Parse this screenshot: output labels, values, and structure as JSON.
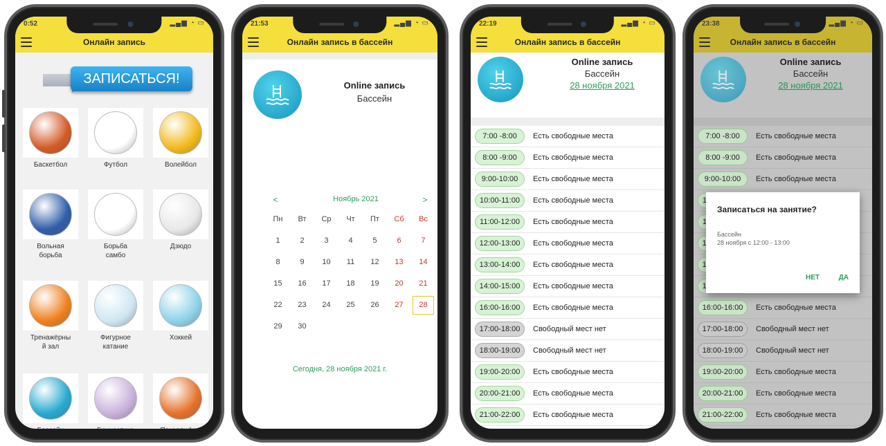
{
  "phone1": {
    "time": "0:52",
    "title": "Онлайн запись",
    "signup_label": "ЗАПИСАТЬСЯ!",
    "sports": [
      {
        "label": "Баскетбол",
        "icon": "basketball-icon",
        "color": "#d35a26"
      },
      {
        "label": "Футбол",
        "icon": "soccer-ball-icon",
        "color": "#ffffff"
      },
      {
        "label": "Волейбол",
        "icon": "volleyball-icon",
        "color": "#f2b91b"
      },
      {
        "label": "Вольная\nборьба",
        "icon": "wrestling-icon",
        "color": "#2f5da8"
      },
      {
        "label": "Борьба\nсамбо",
        "icon": "sambo-icon",
        "color": "#ffffff"
      },
      {
        "label": "Дзюдо",
        "icon": "judo-icon",
        "color": "#e8e8e8"
      },
      {
        "label": "Тренажёрны\nй зал",
        "icon": "dumbbell-icon",
        "color": "#f0801d"
      },
      {
        "label": "Фигурное\nкатание",
        "icon": "figure-skating-icon",
        "color": "#cfe7f2"
      },
      {
        "label": "Хоккей",
        "icon": "hockey-goal-icon",
        "color": "#8fd2ea"
      },
      {
        "label": "Бассейн",
        "icon": "pool-icon",
        "color": "#27a9d0"
      },
      {
        "label": "Гимнастика",
        "icon": "gymnastics-icon",
        "color": "#c9b1dc"
      },
      {
        "label": "Пауэрлифт...",
        "icon": "powerlifting-icon",
        "color": "#e6712a"
      }
    ]
  },
  "phone2": {
    "time": "21:53",
    "title": "Онлайн запись в бассейн",
    "header_line1": "Online запись",
    "header_line2": "Бассейн",
    "calendar": {
      "prev": "<",
      "next": ">",
      "month": "Ноябрь 2021",
      "weekdays": [
        "Пн",
        "Вт",
        "Ср",
        "Чт",
        "Пт",
        "Сб",
        "Вс"
      ],
      "weeks": [
        [
          "1",
          "2",
          "3",
          "4",
          "5",
          "6",
          "7"
        ],
        [
          "8",
          "9",
          "10",
          "11",
          "12",
          "13",
          "14"
        ],
        [
          "15",
          "16",
          "17",
          "18",
          "19",
          "20",
          "21"
        ],
        [
          "22",
          "23",
          "24",
          "25",
          "26",
          "27",
          "28"
        ],
        [
          "29",
          "30",
          "",
          "",
          "",
          "",
          ""
        ]
      ],
      "selected": "28"
    },
    "today": "Сегодня, 28 ноября 2021 г."
  },
  "phone3": {
    "time": "22:19",
    "title": "Онлайн запись в бассейн",
    "header_line1": "Online запись",
    "header_line2": "Бассейн",
    "date": "28 ноября 2021",
    "slots": [
      {
        "time": "7:00 -8:00",
        "status": "Есть свободные места",
        "free": true
      },
      {
        "time": "8:00 -9:00",
        "status": "Есть свободные места",
        "free": true
      },
      {
        "time": "9:00-10:00",
        "status": "Есть свободные места",
        "free": true
      },
      {
        "time": "10:00-11:00",
        "status": "Есть свободные места",
        "free": true
      },
      {
        "time": "11:00-12:00",
        "status": "Есть свободные места",
        "free": true
      },
      {
        "time": "12:00-13:00",
        "status": "Есть свободные места",
        "free": true
      },
      {
        "time": "13:00-14:00",
        "status": "Есть свободные места",
        "free": true
      },
      {
        "time": "14:00-15:00",
        "status": "Есть свободные места",
        "free": true
      },
      {
        "time": "16:00-16:00",
        "status": "Есть свободные места",
        "free": true
      },
      {
        "time": "17:00-18:00",
        "status": "Свободный мест нет",
        "free": false
      },
      {
        "time": "18:00-19:00",
        "status": "Свободный мест нет",
        "free": false
      },
      {
        "time": "19:00-20:00",
        "status": "Есть свободные места",
        "free": true
      },
      {
        "time": "20:00-21:00",
        "status": "Есть свободные места",
        "free": true
      },
      {
        "time": "21:00-22:00",
        "status": "Есть свободные места",
        "free": true
      }
    ]
  },
  "phone4": {
    "time": "23:38",
    "title": "Онлайн запись в бассейн",
    "header_line1": "Online запись",
    "header_line2": "Бассейн",
    "date": "28 ноября 2021",
    "dialog": {
      "title": "Записаться на занятие?",
      "line1": "Бассейн",
      "line2": "28 ноября с 12:00 - 13:00",
      "no": "НЕТ",
      "yes": "ДА"
    }
  },
  "colors": {
    "appbar": "#f4df3c",
    "accent_green": "#2e9c5b",
    "weekend_red": "#c0392b",
    "chip_free": "#d8f2d6",
    "chip_full": "#d5d5d5",
    "signup_blue": "#1881c7"
  }
}
